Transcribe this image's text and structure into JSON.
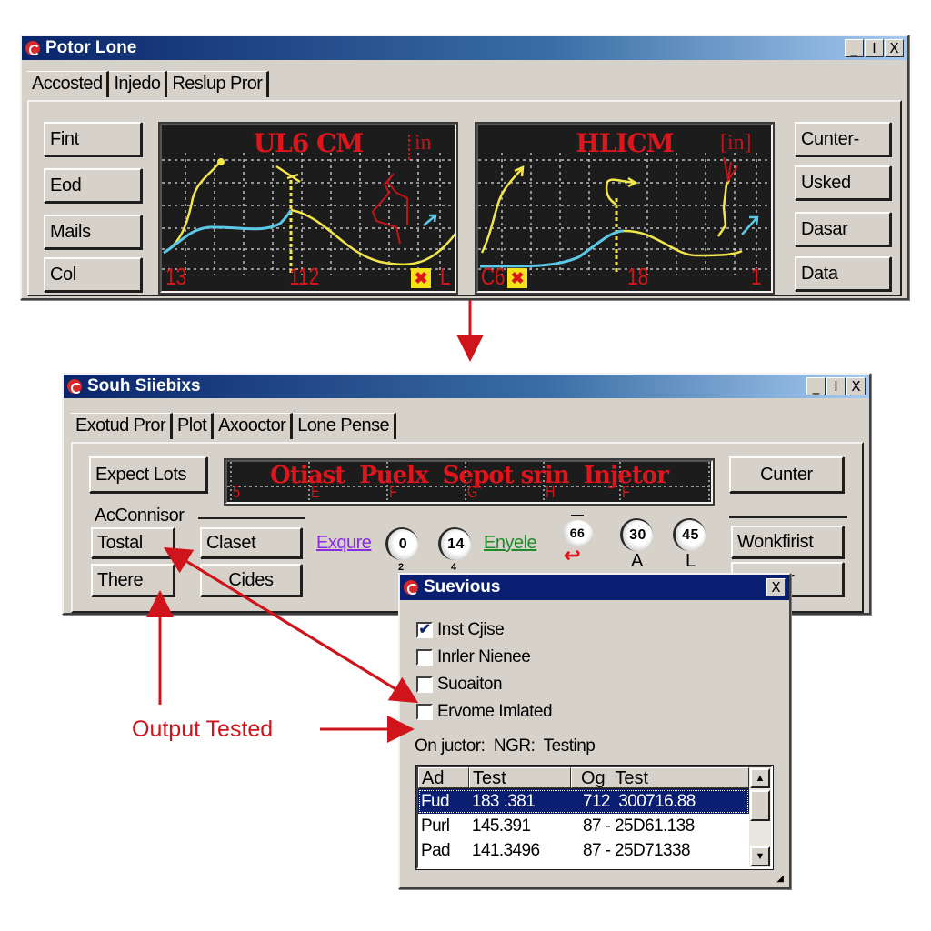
{
  "window1": {
    "title": "Potor Lone",
    "controls": [
      "_",
      "I",
      "X"
    ],
    "tabs": [
      "Accosted",
      "Injedo",
      "Reslup Pror"
    ],
    "left_buttons": [
      "Fint",
      "Eod",
      "Mails",
      "Col"
    ],
    "right_buttons": [
      "Cunter-",
      "Usked",
      "Dasar",
      "Data"
    ],
    "scope1": {
      "title": "UL6 CM",
      "unit": "in",
      "labels": [
        "13",
        "112",
        "L"
      ],
      "warning": "✖"
    },
    "scope2": {
      "title": "HLICM",
      "unit": "[in]",
      "labels": [
        "C6",
        "18",
        "1"
      ],
      "warning": "✖"
    }
  },
  "window2": {
    "title": "Souh Siiebixs",
    "controls": [
      "_",
      "I",
      "X"
    ],
    "tabs": [
      "Exotud Pror",
      "Plot",
      "Axooctor",
      "Lone Pense"
    ],
    "expect_button": "Expect Lots",
    "banner": {
      "title": "Otiast  Puelx  Sepot srin  Injetor",
      "markers": [
        "5",
        "E",
        "F",
        "G",
        "H",
        "F"
      ]
    },
    "group_label": "AcConnisor",
    "group_buttons": [
      "Tostal",
      "There",
      "Claset",
      "Cides"
    ],
    "link_purple": "Exqure",
    "link_green": "Enyele",
    "gauges": [
      {
        "value": "0",
        "sub": "2"
      },
      {
        "value": "14",
        "sub": "4"
      },
      {
        "value": "66",
        "sub": ""
      },
      {
        "value": "30",
        "sub": "A"
      },
      {
        "value": "45",
        "sub": "L"
      }
    ],
    "right_buttons": [
      "Cunter",
      "Wonkfirist",
      "tr"
    ],
    "colors": {
      "link_purple": "#8a2be2",
      "link_green": "#1f8a2a"
    }
  },
  "dialog": {
    "title": "Suevious",
    "close": "X",
    "checkboxes": [
      {
        "label": "Inst Cjise",
        "checked": true
      },
      {
        "label": "Inrler Nienee",
        "checked": false
      },
      {
        "label": "Suoaiton",
        "checked": false
      },
      {
        "label": "Ervome Imlated",
        "checked": false
      }
    ],
    "status": "On juctor:  NGR:  Testinp",
    "table": {
      "columns": [
        "Ad",
        "Test",
        "Og  Test"
      ],
      "rows": [
        [
          "Fud",
          "183 .381",
          "712  300716.88"
        ],
        [
          "Purl",
          "145.391",
          "87 - 25D61.138"
        ],
        [
          "Pad",
          "141.3496",
          "87 - 25D71338"
        ]
      ],
      "selected_row": 0
    }
  },
  "annotation": {
    "label": "Output Tested",
    "color": "#d0141c"
  }
}
